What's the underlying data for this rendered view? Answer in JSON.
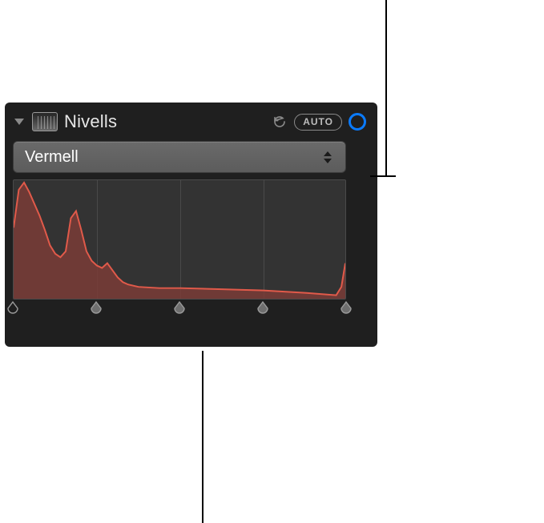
{
  "panel": {
    "title": "Nivells",
    "auto_label": "AUTO",
    "channel_selected": "Vermell"
  },
  "histogram": {
    "grid_divisions": 4,
    "handles": [
      {
        "pos": 0.0,
        "filled": false
      },
      {
        "pos": 0.25,
        "filled": true
      },
      {
        "pos": 0.5,
        "filled": true
      },
      {
        "pos": 0.75,
        "filled": true
      },
      {
        "pos": 1.0,
        "filled": true
      }
    ]
  },
  "colors": {
    "accent": "#0a7bff",
    "hist_stroke": "#e15a4a",
    "hist_fill": "#7a3c37"
  },
  "chart_data": {
    "type": "area",
    "title": "",
    "xlabel": "",
    "ylabel": "",
    "xlim": [
      0,
      255
    ],
    "ylim": [
      0,
      100
    ],
    "series": [
      {
        "name": "Vermell",
        "x": [
          0,
          4,
          8,
          12,
          16,
          20,
          24,
          28,
          32,
          36,
          40,
          44,
          48,
          52,
          56,
          60,
          64,
          68,
          72,
          76,
          80,
          84,
          88,
          96,
          112,
          128,
          160,
          192,
          208,
          224,
          248,
          252,
          255
        ],
        "values": [
          60,
          92,
          98,
          90,
          80,
          70,
          58,
          45,
          38,
          35,
          40,
          68,
          74,
          58,
          40,
          32,
          28,
          26,
          30,
          24,
          18,
          14,
          12,
          10,
          9,
          9,
          8,
          7,
          6,
          5,
          3,
          10,
          30
        ]
      }
    ]
  }
}
